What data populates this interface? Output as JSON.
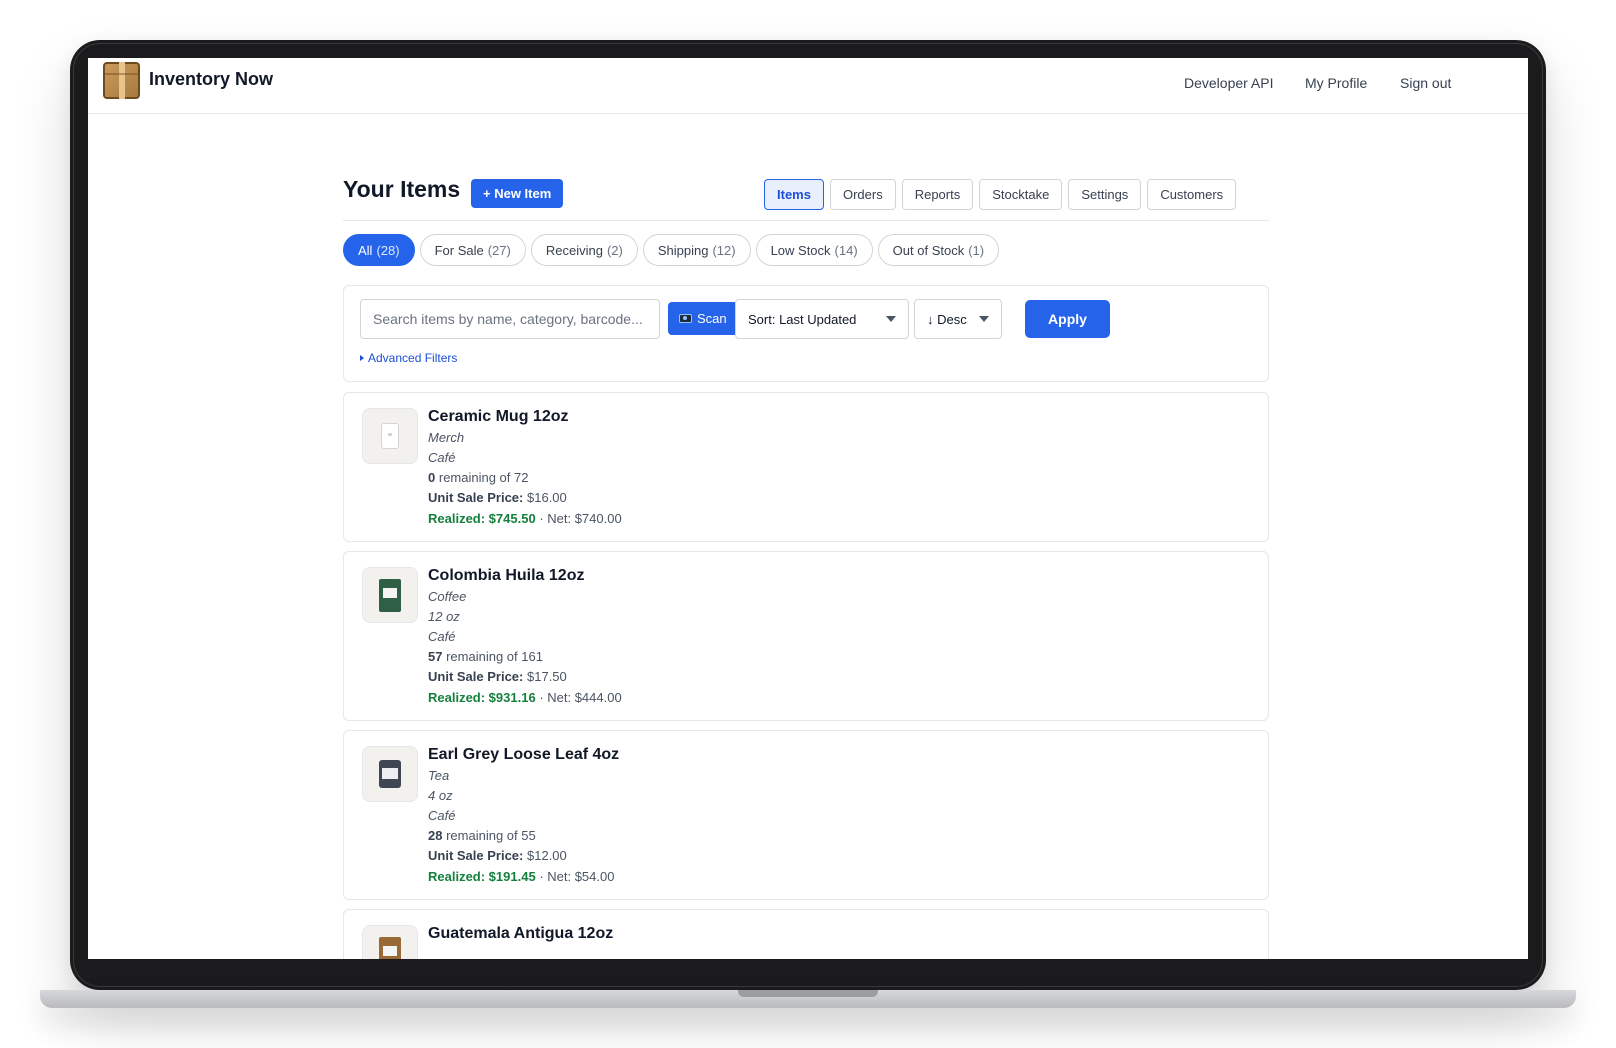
{
  "app": {
    "name": "Inventory Now",
    "nav": [
      "Developer API",
      "My Profile",
      "Sign out"
    ]
  },
  "header": {
    "title": "Your Items",
    "new_item_label": "+ New Item",
    "tabs": [
      {
        "label": "Items",
        "active": true
      },
      {
        "label": "Orders",
        "active": false
      },
      {
        "label": "Reports",
        "active": false
      },
      {
        "label": "Stocktake",
        "active": false
      },
      {
        "label": "Settings",
        "active": false
      },
      {
        "label": "Customers",
        "active": false
      }
    ]
  },
  "filters": {
    "pills": [
      {
        "label": "All",
        "count": "(28)",
        "active": true
      },
      {
        "label": "For Sale",
        "count": "(27)",
        "active": false
      },
      {
        "label": "Receiving",
        "count": "(2)",
        "active": false
      },
      {
        "label": "Shipping",
        "count": "(12)",
        "active": false
      },
      {
        "label": "Low Stock",
        "count": "(14)",
        "active": false
      },
      {
        "label": "Out of Stock",
        "count": "(1)",
        "active": false
      }
    ],
    "search_placeholder": "Search items by name, category, barcode...",
    "search_value": "",
    "scan_label": "Scan",
    "sort_value": "Sort: Last Updated",
    "order_value": "↓ Desc",
    "apply_label": "Apply",
    "advanced_label": "Advanced Filters"
  },
  "items": [
    {
      "name": "Ceramic Mug 12oz",
      "meta": [
        "Merch",
        "Café"
      ],
      "remaining": "0",
      "remaining_rest": "remaining of 72",
      "price_label": "Unit Sale Price:",
      "price": "$16.00",
      "realized": "Realized: $745.50",
      "net": "· Net: $740.00",
      "icon": "mug-icon"
    },
    {
      "name": "Colombia Huila 12oz",
      "meta": [
        "Coffee",
        "12 oz",
        "Café"
      ],
      "remaining": "57",
      "remaining_rest": "remaining of 161",
      "price_label": "Unit Sale Price:",
      "price": "$17.50",
      "realized": "Realized: $931.16",
      "net": "· Net: $444.00",
      "icon": "coffee-bag-icon"
    },
    {
      "name": "Earl Grey Loose Leaf 4oz",
      "meta": [
        "Tea",
        "4 oz",
        "Café"
      ],
      "remaining": "28",
      "remaining_rest": "remaining of 55",
      "price_label": "Unit Sale Price:",
      "price": "$12.00",
      "realized": "Realized: $191.45",
      "net": "· Net: $54.00",
      "icon": "tea-tin-icon"
    },
    {
      "name": "Guatemala Antigua 12oz",
      "meta": [],
      "icon": "coffee-bag-icon"
    }
  ]
}
